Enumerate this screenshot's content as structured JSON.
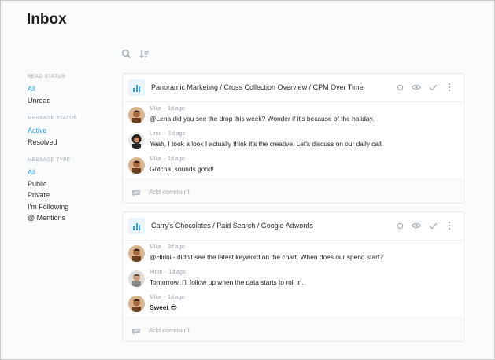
{
  "page": {
    "title": "Inbox"
  },
  "sidebar": {
    "groups": [
      {
        "heading": "READ STATUS",
        "items": [
          {
            "label": "All",
            "active": true
          },
          {
            "label": "Unread",
            "active": false
          }
        ]
      },
      {
        "heading": "MESSAGE STATUS",
        "items": [
          {
            "label": "Active",
            "active": true
          },
          {
            "label": "Resolved",
            "active": false
          }
        ]
      },
      {
        "heading": "MESSAGE TYPE",
        "items": [
          {
            "label": "All",
            "active": true
          },
          {
            "label": "Public",
            "active": false
          },
          {
            "label": "Private",
            "active": false
          },
          {
            "label": "I'm Following",
            "active": false
          },
          {
            "label": "@ Mentions",
            "active": false
          }
        ]
      }
    ]
  },
  "toolbar": {
    "icons": [
      "search-icon",
      "sort-icon"
    ]
  },
  "threads": [
    {
      "title": "Panoramic Marketing / Cross Collection Overview / CPM Over Time",
      "comments": [
        {
          "author": "Mike",
          "time": "1d ago",
          "text": "@Lena did you see the drop this week? Wonder if it's because of the holiday."
        },
        {
          "author": "Lena",
          "time": "1d ago",
          "text": "Yeah, I took a look I actually think it's the creative. Let's discuss on our daily call."
        },
        {
          "author": "Mike",
          "time": "1d ago",
          "text": "Gotcha, sounds good!"
        }
      ],
      "add_comment_placeholder": "Add comment"
    },
    {
      "title": "Carry's Chocolates / Paid Search / Google Adwords",
      "comments": [
        {
          "author": "Mike",
          "time": "3d ago",
          "text": "@Hirini - didn't see the latest keyword on the chart. When does our spend start?"
        },
        {
          "author": "Hirini",
          "time": "1d ago",
          "text": "Tomorrow. I'll follow up when the data starts to roll in."
        },
        {
          "author": "Mike",
          "time": "1d ago",
          "text": "Sweet 😎"
        }
      ],
      "add_comment_placeholder": "Add comment"
    }
  ],
  "colors": {
    "accent": "#2f9de4",
    "muted": "#9aa3ad"
  }
}
